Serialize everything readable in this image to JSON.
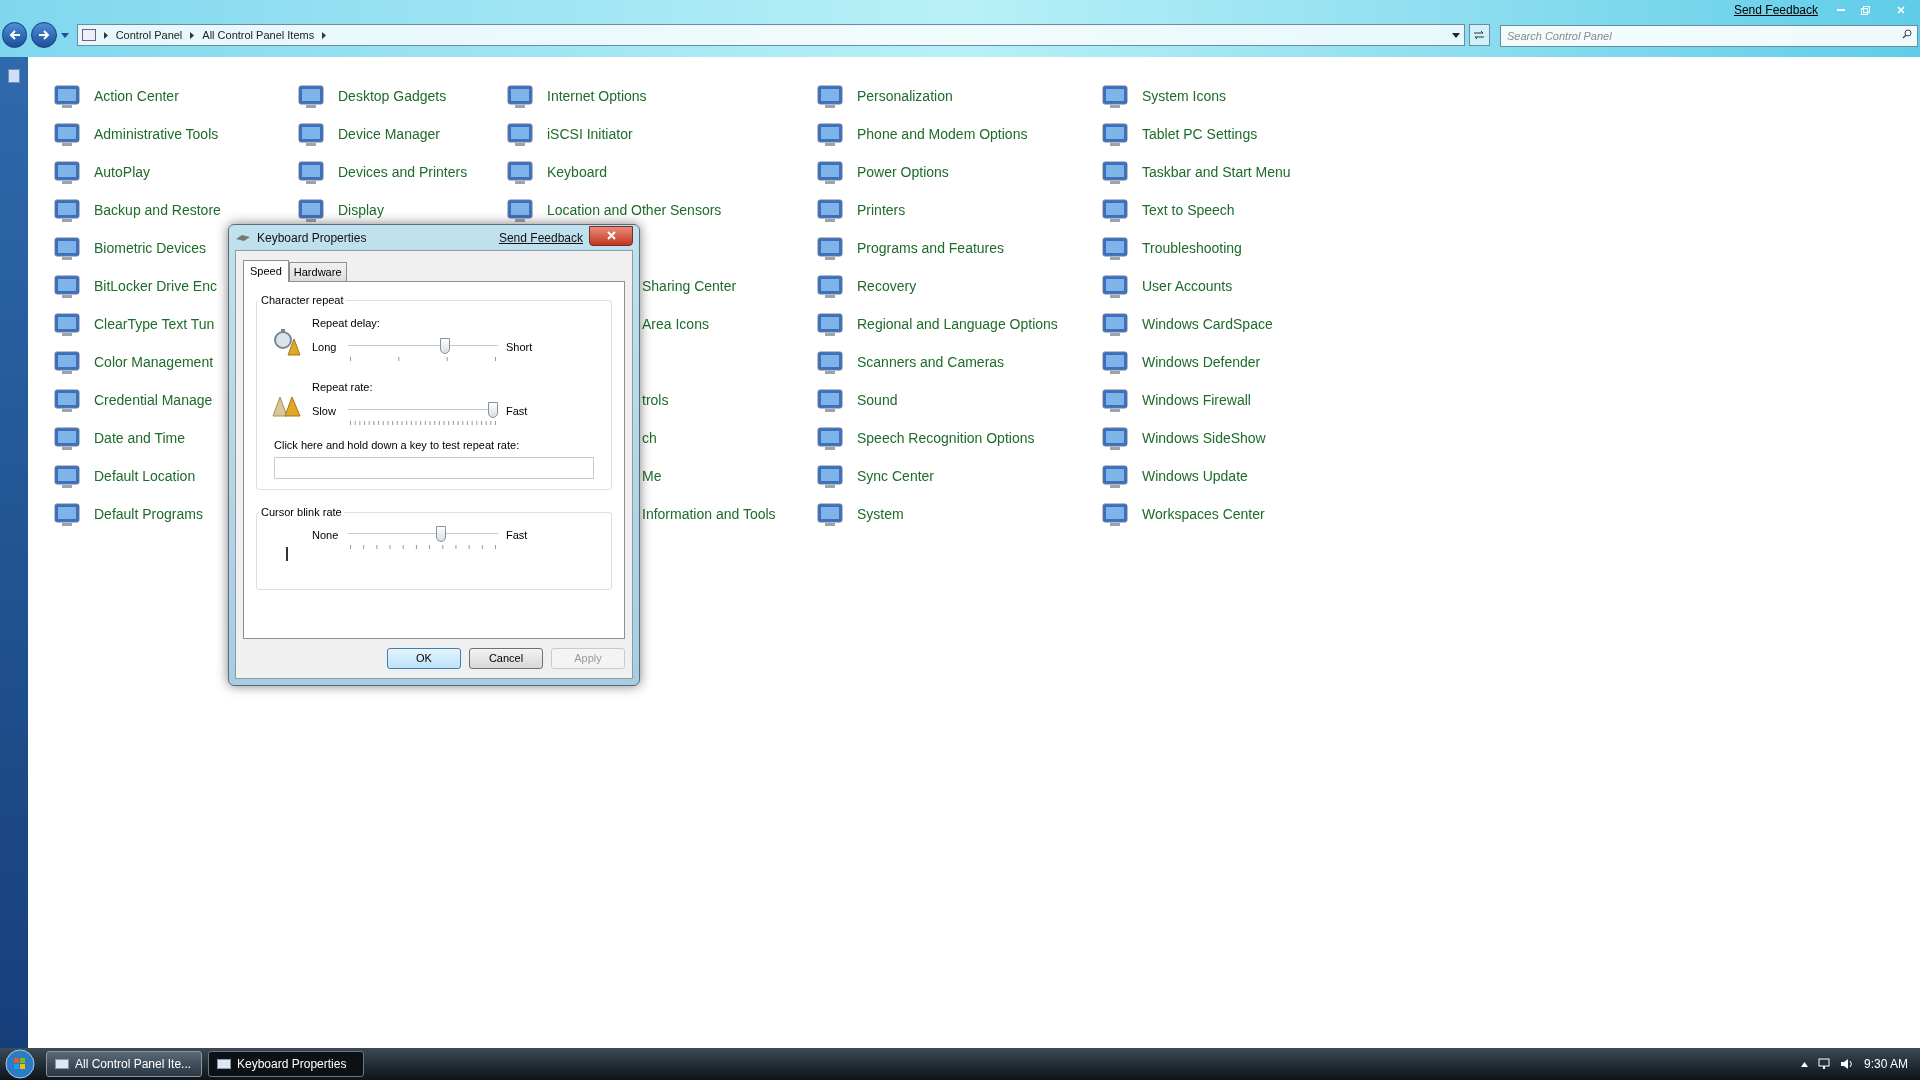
{
  "window": {
    "breadcrumb": [
      "Control Panel",
      "All Control Panel Items"
    ],
    "search": {
      "placeholder": "Search Control Panel"
    },
    "send_feedback": "Send Feedback"
  },
  "columns": [
    [
      {
        "kind": "item",
        "label": "Action Center"
      },
      {
        "kind": "item",
        "label": "Administrative Tools"
      },
      {
        "kind": "item",
        "label": "AutoPlay"
      },
      {
        "kind": "item",
        "label": "Backup and Restore"
      },
      {
        "kind": "item",
        "label": "Biometric Devices"
      },
      {
        "kind": "item",
        "label": "BitLocker Drive Enc"
      },
      {
        "kind": "item",
        "label": "ClearType Text Tun"
      },
      {
        "kind": "item",
        "label": "Color Management"
      },
      {
        "kind": "item",
        "label": "Credential Manage"
      },
      {
        "kind": "item",
        "label": "Date and Time"
      },
      {
        "kind": "item",
        "label": "Default Location"
      },
      {
        "kind": "item",
        "label": "Default Programs"
      }
    ],
    [
      {
        "kind": "item",
        "label": "Desktop Gadgets"
      },
      {
        "kind": "item",
        "label": "Device Manager"
      },
      {
        "kind": "item",
        "label": "Devices and Printers"
      },
      {
        "kind": "item",
        "label": "Display"
      }
    ],
    [
      {
        "kind": "item",
        "label": "Internet Options"
      },
      {
        "kind": "item",
        "label": "iSCSI Initiator"
      },
      {
        "kind": "item",
        "label": "Keyboard"
      },
      {
        "kind": "item",
        "label": "Location and Other Sensors"
      },
      {
        "kind": "covered"
      },
      {
        "kind": "partial",
        "label": "Sharing Center"
      },
      {
        "kind": "partial",
        "label": "Area Icons"
      },
      {
        "kind": "covered"
      },
      {
        "kind": "partial",
        "label": "trols"
      },
      {
        "kind": "partial",
        "label": "ch"
      },
      {
        "kind": "partial",
        "label": "Me"
      },
      {
        "kind": "partial",
        "label": "Information and Tools"
      }
    ],
    [
      {
        "kind": "item",
        "label": "Personalization"
      },
      {
        "kind": "item",
        "label": "Phone and Modem Options"
      },
      {
        "kind": "item",
        "label": "Power Options"
      },
      {
        "kind": "item",
        "label": "Printers"
      },
      {
        "kind": "item",
        "label": "Programs and Features"
      },
      {
        "kind": "item",
        "label": "Recovery"
      },
      {
        "kind": "item",
        "label": "Regional and Language Options"
      },
      {
        "kind": "item",
        "label": "Scanners and Cameras"
      },
      {
        "kind": "item",
        "label": "Sound"
      },
      {
        "kind": "item",
        "label": "Speech Recognition Options"
      },
      {
        "kind": "item",
        "label": "Sync Center"
      },
      {
        "kind": "item",
        "label": "System"
      }
    ],
    [
      {
        "kind": "item",
        "label": "System Icons"
      },
      {
        "kind": "item",
        "label": "Tablet PC Settings"
      },
      {
        "kind": "item",
        "label": "Taskbar and Start Menu"
      },
      {
        "kind": "item",
        "label": "Text to Speech"
      },
      {
        "kind": "item",
        "label": "Troubleshooting"
      },
      {
        "kind": "item",
        "label": "User Accounts"
      },
      {
        "kind": "item",
        "label": "Windows CardSpace"
      },
      {
        "kind": "item",
        "label": "Windows Defender"
      },
      {
        "kind": "item",
        "label": "Windows Firewall"
      },
      {
        "kind": "item",
        "label": "Windows SideShow"
      },
      {
        "kind": "item",
        "label": "Windows Update"
      },
      {
        "kind": "item",
        "label": "Workspaces Center"
      }
    ]
  ],
  "dialog": {
    "title": "Keyboard Properties",
    "send_feedback": "Send Feedback",
    "tabs": [
      {
        "label": "Speed",
        "selected": true
      },
      {
        "label": "Hardware",
        "selected": false
      }
    ],
    "groups": [
      {
        "title": "Character repeat",
        "sliders": [
          {
            "kind": "delay",
            "label": "Repeat delay:",
            "min_label": "Long",
            "max_label": "Short",
            "level": 0.66
          },
          {
            "kind": "rate",
            "label": "Repeat rate:",
            "min_label": "Slow",
            "max_label": "Fast",
            "level": 1
          }
        ],
        "test_label": "Click here and hold down a key to test repeat rate:"
      },
      {
        "title": "Cursor blink rate",
        "sliders": [
          {
            "kind": "blink",
            "min_label": "None",
            "max_label": "Fast",
            "level": 0.63
          }
        ]
      }
    ],
    "buttons": [
      {
        "label": "OK",
        "default": true,
        "disabled": false
      },
      {
        "label": "Cancel",
        "default": false,
        "disabled": false
      },
      {
        "label": "Apply",
        "default": false,
        "disabled": true
      }
    ]
  },
  "taskbar": {
    "tasks": [
      {
        "label": "All Control Panel Ite...",
        "selected": false
      },
      {
        "label": "Keyboard Properties",
        "selected": true
      }
    ],
    "clock": "9:30 AM"
  }
}
